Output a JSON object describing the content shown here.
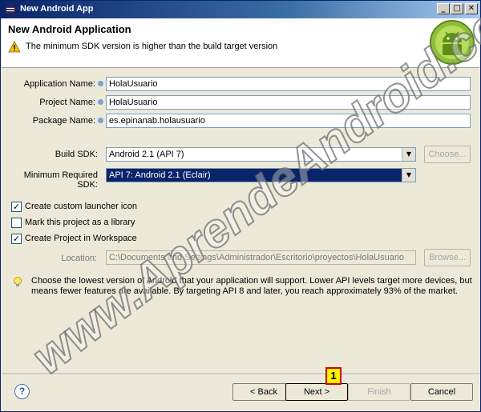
{
  "window": {
    "title": "New Android App",
    "controls": {
      "minimize": "_",
      "maximize": "□",
      "close": "✕"
    }
  },
  "header": {
    "heading": "New Android Application",
    "warning_icon": "warning-icon",
    "warning": "The minimum SDK version is higher than the build target version",
    "logo_icon": "android-logo"
  },
  "form": {
    "application_name": {
      "label": "Application Name:",
      "value": "HolaUsuario"
    },
    "project_name": {
      "label": "Project Name:",
      "value": "HolaUsuario"
    },
    "package_name": {
      "label": "Package Name:",
      "value": "es.epinanab.holausuario"
    },
    "build_sdk": {
      "label": "Build SDK:",
      "value": "Android 2.1 (API 7)",
      "choose_label": "Choose..."
    },
    "min_sdk": {
      "label": "Minimum Required SDK:",
      "value": "API 7: Android 2.1 (Eclair)"
    }
  },
  "options": {
    "custom_launcher_icon": {
      "label": "Create custom launcher icon",
      "checked": true
    },
    "library": {
      "label": "Mark this project as a library",
      "checked": false
    },
    "workspace": {
      "label": "Create Project in Workspace",
      "checked": true
    }
  },
  "location": {
    "label": "Location:",
    "value": "C:\\Documents and Settings\\Administrador\\Escritorio\\proyectos\\HolaUsuario",
    "browse_label": "Browse..."
  },
  "hint": {
    "icon": "lightbulb-icon",
    "text": "Choose the lowest version of Android that your application will support. Lower API levels target more devices, but means fewer features are available. By targeting API 8 and later, you reach approximately 93% of the market."
  },
  "footer": {
    "help": "?",
    "back": "< Back",
    "next": "Next >",
    "finish": "Finish",
    "cancel": "Cancel"
  },
  "annotation": {
    "marker": "1"
  },
  "watermark": {
    "text": "www.AprendeAndroid.com"
  },
  "colors": {
    "selection": "#0a246a",
    "titlebar": "#0a246a",
    "marker_fill": "#fff200",
    "marker_border": "#d00000"
  }
}
